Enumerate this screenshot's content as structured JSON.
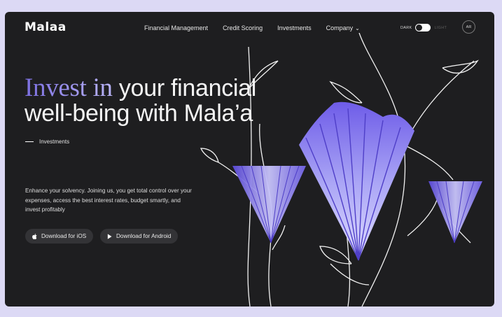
{
  "brand": {
    "logo_text": "Malaa"
  },
  "nav": {
    "items": [
      "Financial Management",
      "Credit Scoring",
      "Investments",
      "Company"
    ]
  },
  "theme": {
    "dark_label": "DARK",
    "light_label": "LIGHT",
    "dark_on": true
  },
  "user": {
    "initials": "AR"
  },
  "hero": {
    "accent": "Invest in",
    "line1_rest": " your financial",
    "line2": "well-being with Mala’a"
  },
  "tag": {
    "label": "Investments"
  },
  "description": "Enhance your solvency. Joining us, you get total control over your expenses, access the best interest rates, budget smartly, and invest profitably",
  "buttons": {
    "ios": "Download for iOS",
    "android": "Download for Android"
  },
  "colors": {
    "background": "#1e1e20",
    "page": "#dcd9f5",
    "accent": "#7c6fe0",
    "flower": "#8b7cf6"
  },
  "icons": [
    "apple-icon",
    "play-icon",
    "chevron-down-icon"
  ]
}
